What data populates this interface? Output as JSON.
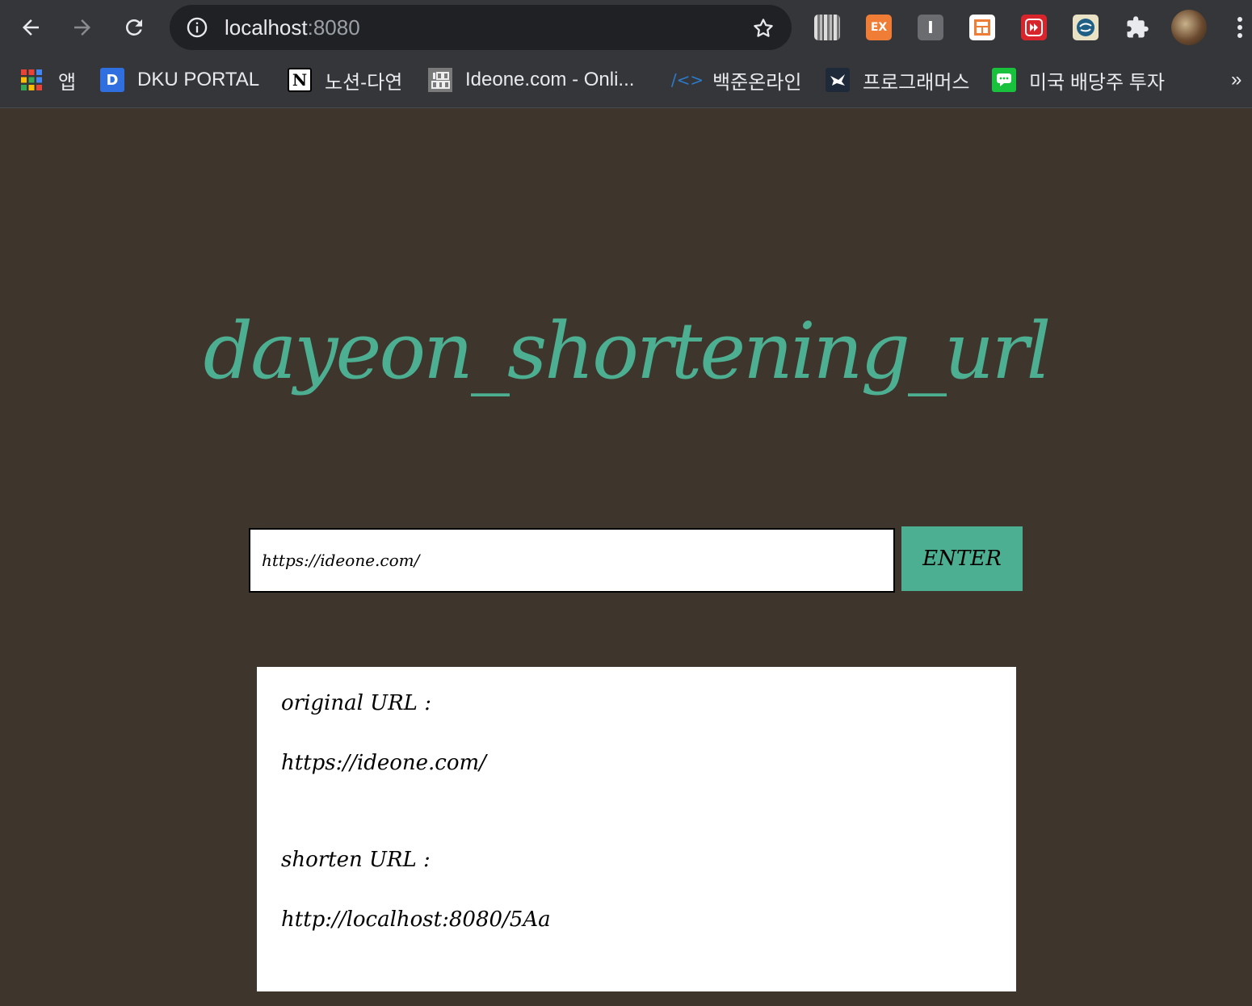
{
  "browser": {
    "address_host": "localhost",
    "address_port": ":8080",
    "bookmarks": [
      {
        "label": "앱",
        "icon": "apps-grid-icon"
      },
      {
        "label": "DKU PORTAL",
        "icon": "dku-portal-icon"
      },
      {
        "label": "노션-다연",
        "icon": "notion-icon"
      },
      {
        "label": "Ideone.com - Onli...",
        "icon": "ideone-icon"
      },
      {
        "label": "백준온라인",
        "icon": "baekjoon-icon"
      },
      {
        "label": "프로그래머스",
        "icon": "programmers-icon"
      },
      {
        "label": "미국 배당주 투자",
        "icon": "chat-icon"
      }
    ],
    "more_bookmarks": "»",
    "extensions": [
      {
        "name": "barcode-extension-icon",
        "text": ""
      },
      {
        "name": "ex-extension-icon",
        "text": "EX"
      },
      {
        "name": "i-extension-icon",
        "text": "I"
      },
      {
        "name": "layout-extension-icon",
        "text": ""
      },
      {
        "name": "fast-forward-extension-icon",
        "text": ""
      },
      {
        "name": "globe-extension-icon",
        "text": ""
      }
    ]
  },
  "page": {
    "title": "dayeon_shortening_url",
    "input_value": "https://ideone.com/",
    "enter_label": "ENTER",
    "original_label": "original URL :",
    "original_value": "https://ideone.com/",
    "shorten_label": "shorten URL :",
    "shorten_value": "http://localhost:8080/5Aa"
  },
  "colors": {
    "background": "#3e352c",
    "accent": "#4daf91",
    "chrome": "#35363a"
  }
}
